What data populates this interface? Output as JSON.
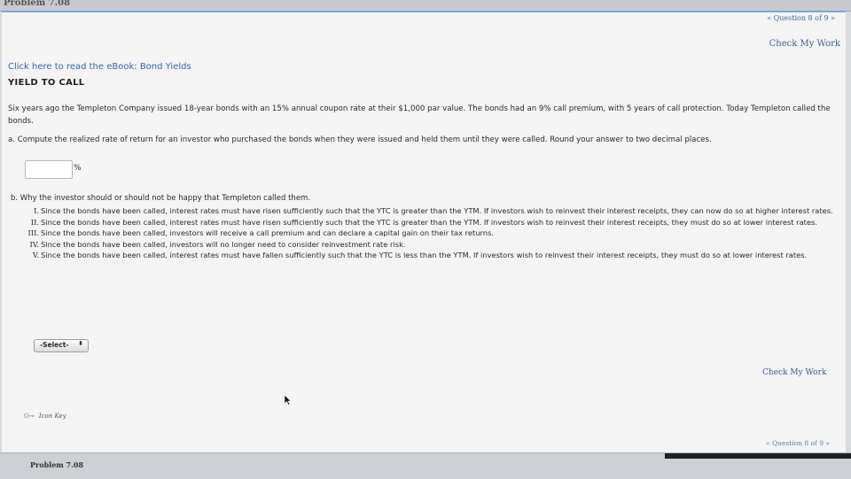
{
  "header": {
    "problem_title": "Problem 7.08"
  },
  "nav": {
    "question_top": "« Question 8 of 9 »",
    "question_bottom": "« Question 8 of 9 »",
    "check_top": "Check My Work",
    "check_bottom": "Check My Work"
  },
  "content": {
    "ebook_link": "Click here to read the eBook: Bond Yields",
    "section_title": "YIELD TO CALL",
    "intro": "Six years ago the Templeton Company issued 18-year bonds with an 15% annual coupon rate at their $1,000 par value. The bonds had an 9% call premium, with 5 years of call protection. Today Templeton called the bonds.",
    "part_a": "a. Compute the realized rate of return for an investor who purchased the bonds when they were issued and held them until they were called. Round your answer to two decimal places.",
    "answer_value": "",
    "answer_unit": "%",
    "part_b": "b. Why the investor should or should not be happy that Templeton called them.",
    "options": [
      {
        "num": "I.",
        "text": "Since the bonds have been called, interest rates must have risen sufficiently such that the YTC is greater than the YTM. If investors wish to reinvest their interest receipts, they can now do so at higher interest rates."
      },
      {
        "num": "II.",
        "text": "Since the bonds have been called, interest rates must have risen sufficiently such that the YTC is greater than the YTM. If investors wish to reinvest their interest receipts, they must do so at lower interest rates."
      },
      {
        "num": "III.",
        "text": "Since the bonds have been called, investors will receive a call premium and can declare a capital gain on their tax returns."
      },
      {
        "num": "IV.",
        "text": "Since the bonds have been called, investors will no longer need to consider reinvestment rate risk."
      },
      {
        "num": "V.",
        "text": "Since the bonds have been called, interest rates must have fallen sufficiently such that the YTC is less than the YTM. If investors wish to reinvest their interest receipts, they must do so at lower interest rates."
      }
    ],
    "select_value": "-Select-",
    "select_arrow": "⬍",
    "icon_key": "Icon Key",
    "key_icon": "key-icon",
    "cursor_icon": "cursor-icon"
  },
  "footer": {
    "problem_title": "Problem 7.08"
  },
  "colors": {
    "link": "#3567b0",
    "panel": "#f4f4f4",
    "accent_border": "#7fa6cf"
  }
}
